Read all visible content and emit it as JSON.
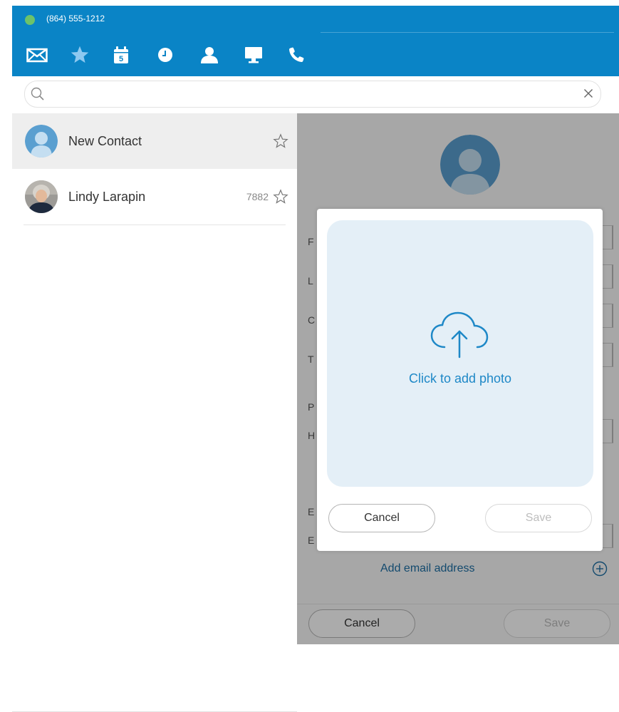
{
  "colors": {
    "brand": "#0a84c6",
    "accent": "#1e88c7",
    "online": "#6cc26a",
    "dropzone": "#e4eff7",
    "nav_icon": "#ffffff",
    "nav_star": "#8ec9f0"
  },
  "header": {
    "phone_number": "(864) 555-1212",
    "nav_icons": [
      "envelope-icon",
      "star-icon",
      "calendar-icon",
      "clock-icon",
      "person-icon",
      "monitor-icon",
      "phone-icon"
    ],
    "calendar_day": "5"
  },
  "search": {
    "value": "",
    "placeholder": "",
    "clear_icon": "close-icon"
  },
  "contacts": [
    {
      "name": "New Contact",
      "extension": "",
      "selected": true,
      "avatar": "placeholder-avatar",
      "favorite": false
    },
    {
      "name": "Lindy Larapin",
      "extension": "7882",
      "selected": false,
      "avatar": "photo-avatar",
      "favorite": false
    }
  ],
  "detail": {
    "field_labels": [
      "F",
      "L",
      "C",
      "T",
      "P",
      "H",
      "E",
      "E"
    ],
    "add_email_label": "Add email address",
    "cancel_label": "Cancel",
    "save_label": "Save"
  },
  "modal": {
    "dropzone_label": "Click to add photo",
    "upload_icon": "cloud-upload-icon",
    "cancel_label": "Cancel",
    "save_label": "Save"
  }
}
